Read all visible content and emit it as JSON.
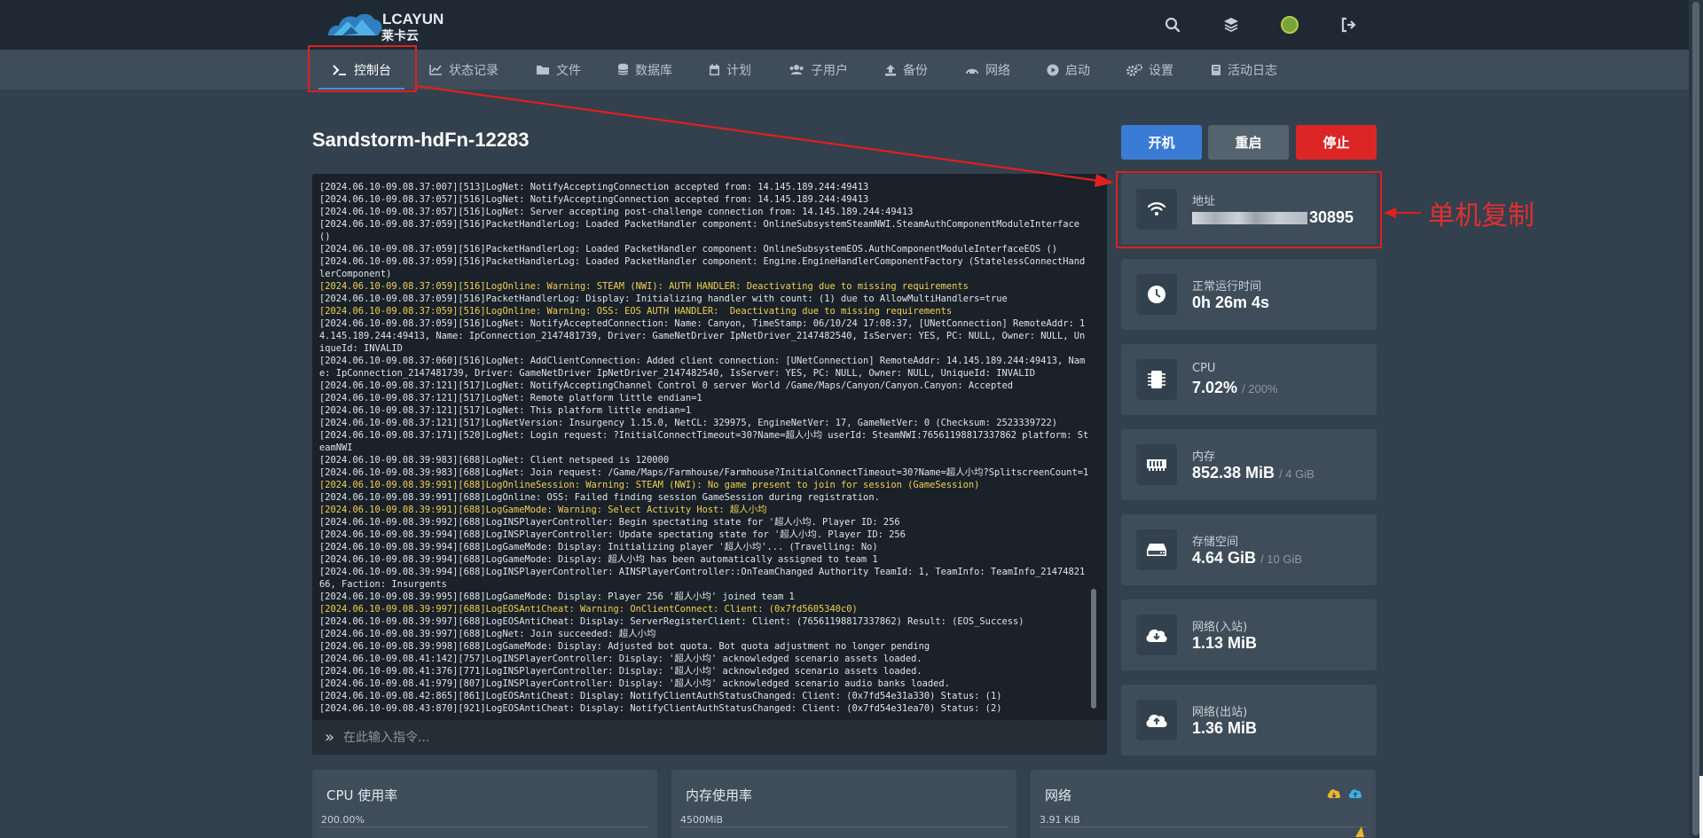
{
  "header": {
    "logo_top": "LCAYUN",
    "logo_bottom": "莱卡云"
  },
  "nav": {
    "items": [
      {
        "label": "控制台",
        "icon": "terminal-icon"
      },
      {
        "label": "状态记录",
        "icon": "chart-line-icon"
      },
      {
        "label": "文件",
        "icon": "folder-icon"
      },
      {
        "label": "数据库",
        "icon": "database-icon"
      },
      {
        "label": "计划",
        "icon": "calendar-icon"
      },
      {
        "label": "子用户",
        "icon": "users-icon"
      },
      {
        "label": "备份",
        "icon": "upload-icon"
      },
      {
        "label": "网络",
        "icon": "network-icon"
      },
      {
        "label": "启动",
        "icon": "play-circle-icon"
      },
      {
        "label": "设置",
        "icon": "cogs-icon"
      },
      {
        "label": "活动日志",
        "icon": "book-icon"
      }
    ]
  },
  "server": {
    "title": "Sandstorm-hdFn-12283"
  },
  "controls": {
    "start": "开机",
    "restart": "重启",
    "stop": "停止",
    "colors": {
      "start": "#3a7bd5",
      "restart": "#55636f",
      "stop": "#dc2626"
    }
  },
  "console": {
    "placeholder": "在此输入指令...",
    "lines": [
      {
        "t": "[2024.06.10-09.08.37:007][513]LogNet: NotifyAcceptingConnection accepted from: 14.145.189.244:49413",
        "w": false
      },
      {
        "t": "[2024.06.10-09.08.37:057][516]LogNet: NotifyAcceptingConnection accepted from: 14.145.189.244:49413",
        "w": false
      },
      {
        "t": "[2024.06.10-09.08.37:057][516]LogNet: Server accepting post-challenge connection from: 14.145.189.244:49413",
        "w": false
      },
      {
        "t": "[2024.06.10-09.08.37:059][516]PacketHandlerLog: Loaded PacketHandler component: OnlineSubsystemSteamNWI.SteamAuthComponentModuleInterface ()",
        "w": false
      },
      {
        "t": "[2024.06.10-09.08.37:059][516]PacketHandlerLog: Loaded PacketHandler component: OnlineSubsystemEOS.AuthComponentModuleInterfaceEOS ()",
        "w": false
      },
      {
        "t": "[2024.06.10-09.08.37:059][516]PacketHandlerLog: Loaded PacketHandler component: Engine.EngineHandlerComponentFactory (StatelessConnectHandlerComponent)",
        "w": false
      },
      {
        "t": "[2024.06.10-09.08.37:059][516]LogOnline: Warning: STEAM (NWI): AUTH HANDLER: Deactivating due to missing requirements",
        "w": true
      },
      {
        "t": "[2024.06.10-09.08.37:059][516]PacketHandlerLog: Display: Initializing handler with count: (1) due to AllowMultiHandlers=true",
        "w": false
      },
      {
        "t": "[2024.06.10-09.08.37:059][516]LogOnline: Warning: OSS: EOS AUTH HANDLER:  Deactivating due to missing requirements",
        "w": true
      },
      {
        "t": "[2024.06.10-09.08.37:059][516]LogNet: NotifyAcceptedConnection: Name: Canyon, TimeStamp: 06/10/24 17:08:37, [UNetConnection] RemoteAddr: 14.145.189.244:49413, Name: IpConnection_2147481739, Driver: GameNetDriver IpNetDriver_2147482540, IsServer: YES, PC: NULL, Owner: NULL, UniqueId: INVALID",
        "w": false
      },
      {
        "t": "[2024.06.10-09.08.37:060][516]LogNet: AddClientConnection: Added client connection: [UNetConnection] RemoteAddr: 14.145.189.244:49413, Name: IpConnection_2147481739, Driver: GameNetDriver IpNetDriver_2147482540, IsServer: YES, PC: NULL, Owner: NULL, UniqueId: INVALID",
        "w": false
      },
      {
        "t": "[2024.06.10-09.08.37:121][517]LogNet: NotifyAcceptingChannel Control 0 server World /Game/Maps/Canyon/Canyon.Canyon: Accepted",
        "w": false
      },
      {
        "t": "[2024.06.10-09.08.37:121][517]LogNet: Remote platform little endian=1",
        "w": false
      },
      {
        "t": "[2024.06.10-09.08.37:121][517]LogNet: This platform little endian=1",
        "w": false
      },
      {
        "t": "[2024.06.10-09.08.37:121][517]LogNetVersion: Insurgency 1.15.0, NetCL: 329975, EngineNetVer: 17, GameNetVer: 0 (Checksum: 2523339722)",
        "w": false
      },
      {
        "t": "[2024.06.10-09.08.37:171][520]LogNet: Login request: ?InitialConnectTimeout=30?Name=超人小均 userId: SteamNWI:76561198817337862 platform: SteamNWI",
        "w": false
      },
      {
        "t": "[2024.06.10-09.08.39:983][688]LogNet: Client netspeed is 120000",
        "w": false
      },
      {
        "t": "[2024.06.10-09.08.39:983][688]LogNet: Join request: /Game/Maps/Farmhouse/Farmhouse?InitialConnectTimeout=30?Name=超人小均?SplitscreenCount=1",
        "w": false
      },
      {
        "t": "[2024.06.10-09.08.39:991][688]LogOnlineSession: Warning: STEAM (NWI): No game present to join for session (GameSession)",
        "w": true
      },
      {
        "t": "[2024.06.10-09.08.39:991][688]LogOnline: OSS: Failed finding session GameSession during registration.",
        "w": false
      },
      {
        "t": "[2024.06.10-09.08.39:991][688]LogGameMode: Warning: Select Activity Host: 超人小均",
        "w": true
      },
      {
        "t": "[2024.06.10-09.08.39:992][688]LogINSPlayerController: Begin spectating state for '超人小均. Player ID: 256",
        "w": false
      },
      {
        "t": "[2024.06.10-09.08.39:994][688]LogINSPlayerController: Update spectating state for '超人小均. Player ID: 256",
        "w": false
      },
      {
        "t": "[2024.06.10-09.08.39:994][688]LogGameMode: Display: Initializing player '超人小均'... (Travelling: No)",
        "w": false
      },
      {
        "t": "[2024.06.10-09.08.39:994][688]LogGameMode: Display: 超人小均 has been automatically assigned to team 1",
        "w": false
      },
      {
        "t": "[2024.06.10-09.08.39:994][688]LogINSPlayerController: AINSPlayerController::OnTeamChanged Authority TeamId: 1, TeamInfo: TeamInfo_2147482166, Faction: Insurgents",
        "w": false
      },
      {
        "t": "[2024.06.10-09.08.39:995][688]LogGameMode: Display: Player 256 '超人小均' joined team 1",
        "w": false
      },
      {
        "t": "[2024.06.10-09.08.39:997][688]LogEOSAntiCheat: Warning: OnClientConnect: Client: (0x7fd5605340c0)",
        "w": true
      },
      {
        "t": "[2024.06.10-09.08.39:997][688]LogEOSAntiCheat: Display: ServerRegisterClient: Client: (76561198817337862) Result: (EOS_Success)",
        "w": false
      },
      {
        "t": "[2024.06.10-09.08.39:997][688]LogNet: Join succeeded: 超人小均",
        "w": false
      },
      {
        "t": "[2024.06.10-09.08.39:998][688]LogGameMode: Display: Adjusted bot quota. Bot quota adjustment no longer pending",
        "w": false
      },
      {
        "t": "[2024.06.10-09.08.41:142][757]LogINSPlayerController: Display: '超人小均' acknowledged scenario assets loaded.",
        "w": false
      },
      {
        "t": "[2024.06.10-09.08.41:376][771]LogINSPlayerController: Display: '超人小均' acknowledged scenario assets loaded.",
        "w": false
      },
      {
        "t": "[2024.06.10-09.08.41:979][807]LogINSPlayerController: Display: '超人小均' acknowledged scenario audio banks loaded.",
        "w": false
      },
      {
        "t": "[2024.06.10-09.08.42:865][861]LogEOSAntiCheat: Display: NotifyClientAuthStatusChanged: Client: (0x7fd54e31a330) Status: (1)",
        "w": false
      },
      {
        "t": "[2024.06.10-09.08.43:870][921]LogEOSAntiCheat: Display: NotifyClientAuthStatusChanged: Client: (0x7fd54e31ea70) Status: (2)",
        "w": false
      }
    ]
  },
  "stats": {
    "address": {
      "label": "地址",
      "value": "30895",
      "icon": "wifi-icon"
    },
    "uptime": {
      "label": "正常运行时间",
      "value": "0h 26m 4s",
      "icon": "clock-icon"
    },
    "cpu": {
      "label": "CPU",
      "value": "7.02%",
      "sub": "/ 200%",
      "icon": "cpu-chip-icon"
    },
    "memory": {
      "label": "内存",
      "value": "852.38 MiB",
      "sub": "/ 4 GiB",
      "icon": "memory-icon"
    },
    "storage": {
      "label": "存储空间",
      "value": "4.64 GiB",
      "sub": "/ 10 GiB",
      "icon": "hdd-icon"
    },
    "net_in": {
      "label": "网络(入站)",
      "value": "1.13 MiB",
      "icon": "cloud-download-icon"
    },
    "net_out": {
      "label": "网络(出站)",
      "value": "1.36 MiB",
      "icon": "cloud-upload-icon"
    }
  },
  "annotation": {
    "label": "单机复制",
    "color": "#e02020"
  },
  "panels": {
    "cpu": {
      "title": "CPU 使用率",
      "max": "200.00%"
    },
    "memory": {
      "title": "内存使用率",
      "max": "4500MiB"
    },
    "network": {
      "title": "网络",
      "max": "3.91 KiB"
    }
  }
}
